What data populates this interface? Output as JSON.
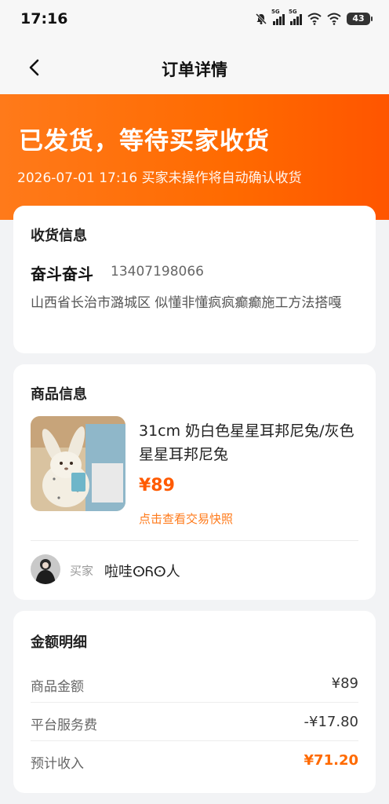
{
  "status_bar": {
    "time": "17:16",
    "sim1": "5G",
    "sim2": "5G",
    "battery": "43"
  },
  "nav": {
    "title": "订单详情",
    "back_icon": "chevron-left-icon"
  },
  "banner": {
    "title": "已发货，等待买家收货",
    "subtitle": "2026-07-01 17:16 买家未操作将自动确认收货",
    "color": "#ff6a00"
  },
  "address": {
    "section_title": "收货信息",
    "receiver": "奋斗奋斗",
    "phone": "13407198066",
    "detail": "山西省长治市潞城区 似懂非懂疯疯癫癫施工方法搭嘎"
  },
  "goods": {
    "section_title": "商品信息",
    "name": "31cm 奶白色星星耳邦尼兔/灰色星星耳邦尼兔",
    "price": "¥89",
    "snapshot_link": "点击查看交易快照",
    "buyer_label": "买家",
    "buyer_name": "啦哇ⵙᏲⵙ人"
  },
  "amount": {
    "section_title": "金额明细",
    "rows": [
      {
        "label": "商品金额",
        "value": "¥89"
      },
      {
        "label": "平台服务费",
        "value": "-¥17.80"
      },
      {
        "label": "预计收入",
        "value": "¥71.20"
      }
    ],
    "income_color": "#ff6a00"
  }
}
